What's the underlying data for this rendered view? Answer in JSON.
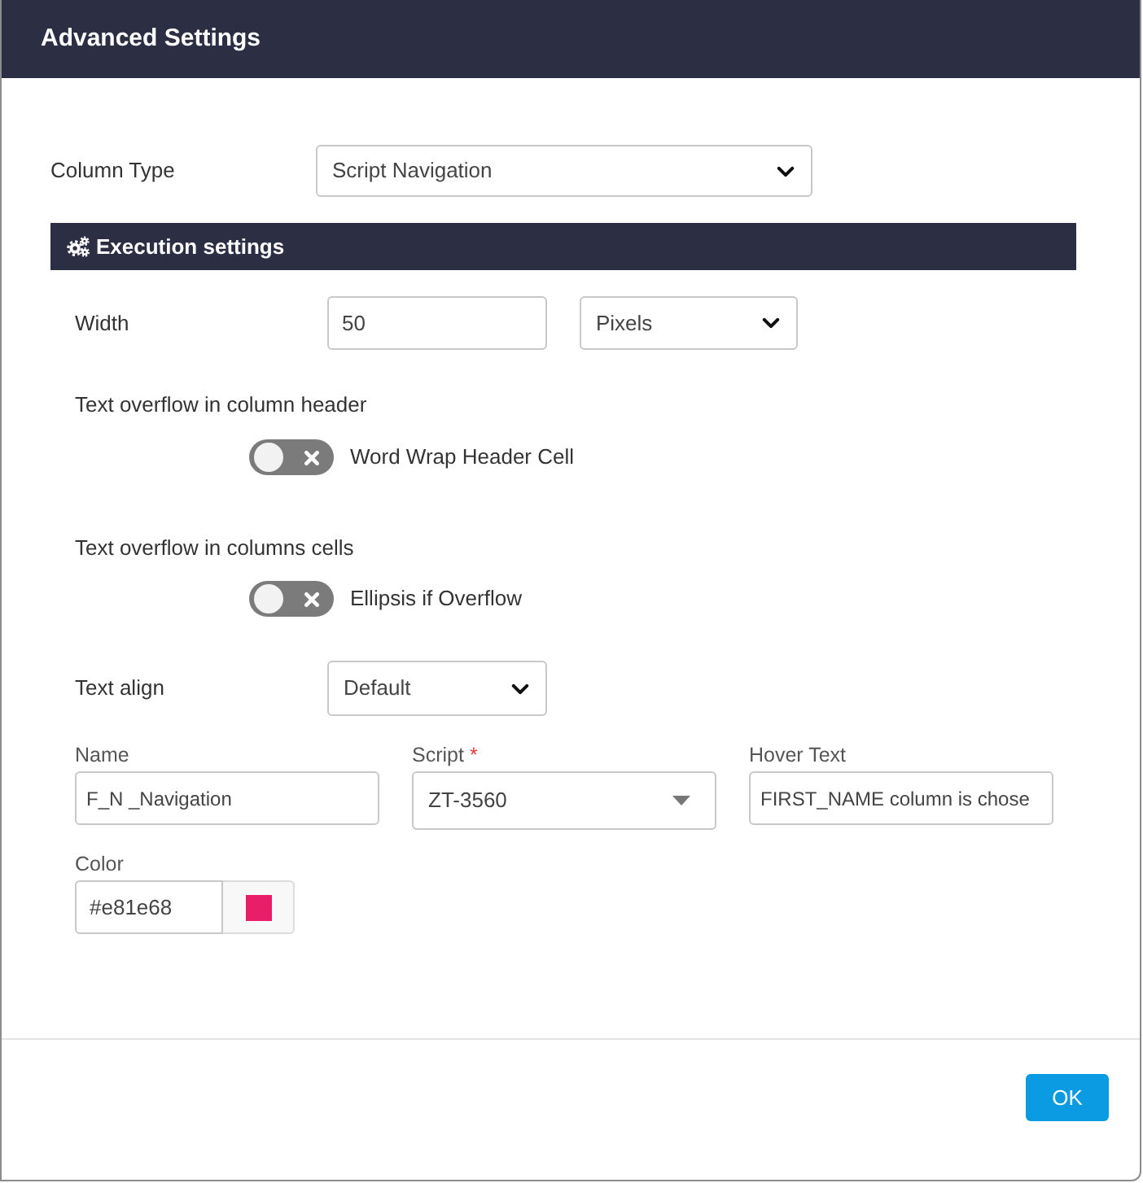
{
  "window": {
    "title": "Advanced Settings"
  },
  "column_type": {
    "label": "Column Type",
    "value": "Script Navigation"
  },
  "section": {
    "title": "Execution settings"
  },
  "width": {
    "label": "Width",
    "value": "50",
    "unit": "Pixels"
  },
  "toggles": [
    {
      "caption": "Text overflow in column header",
      "label": "Word Wrap Header Cell",
      "on": false
    },
    {
      "caption": "Text overflow in columns cells",
      "label": "Ellipsis if Overflow",
      "on": false
    }
  ],
  "text_align": {
    "label": "Text align",
    "value": "Default"
  },
  "fields": [
    {
      "kind": "text",
      "label": "Name",
      "value": "F_N _Navigation"
    },
    {
      "kind": "combo",
      "label": "Script",
      "required_mark": "*",
      "value": "ZT-3560"
    },
    {
      "kind": "text",
      "label": "Hover Text",
      "value": "FIRST_NAME column is chose"
    }
  ],
  "color_field": {
    "label": "Color",
    "value": "#e81e68",
    "color": "#e81e68"
  },
  "buttons": [
    "OK"
  ]
}
